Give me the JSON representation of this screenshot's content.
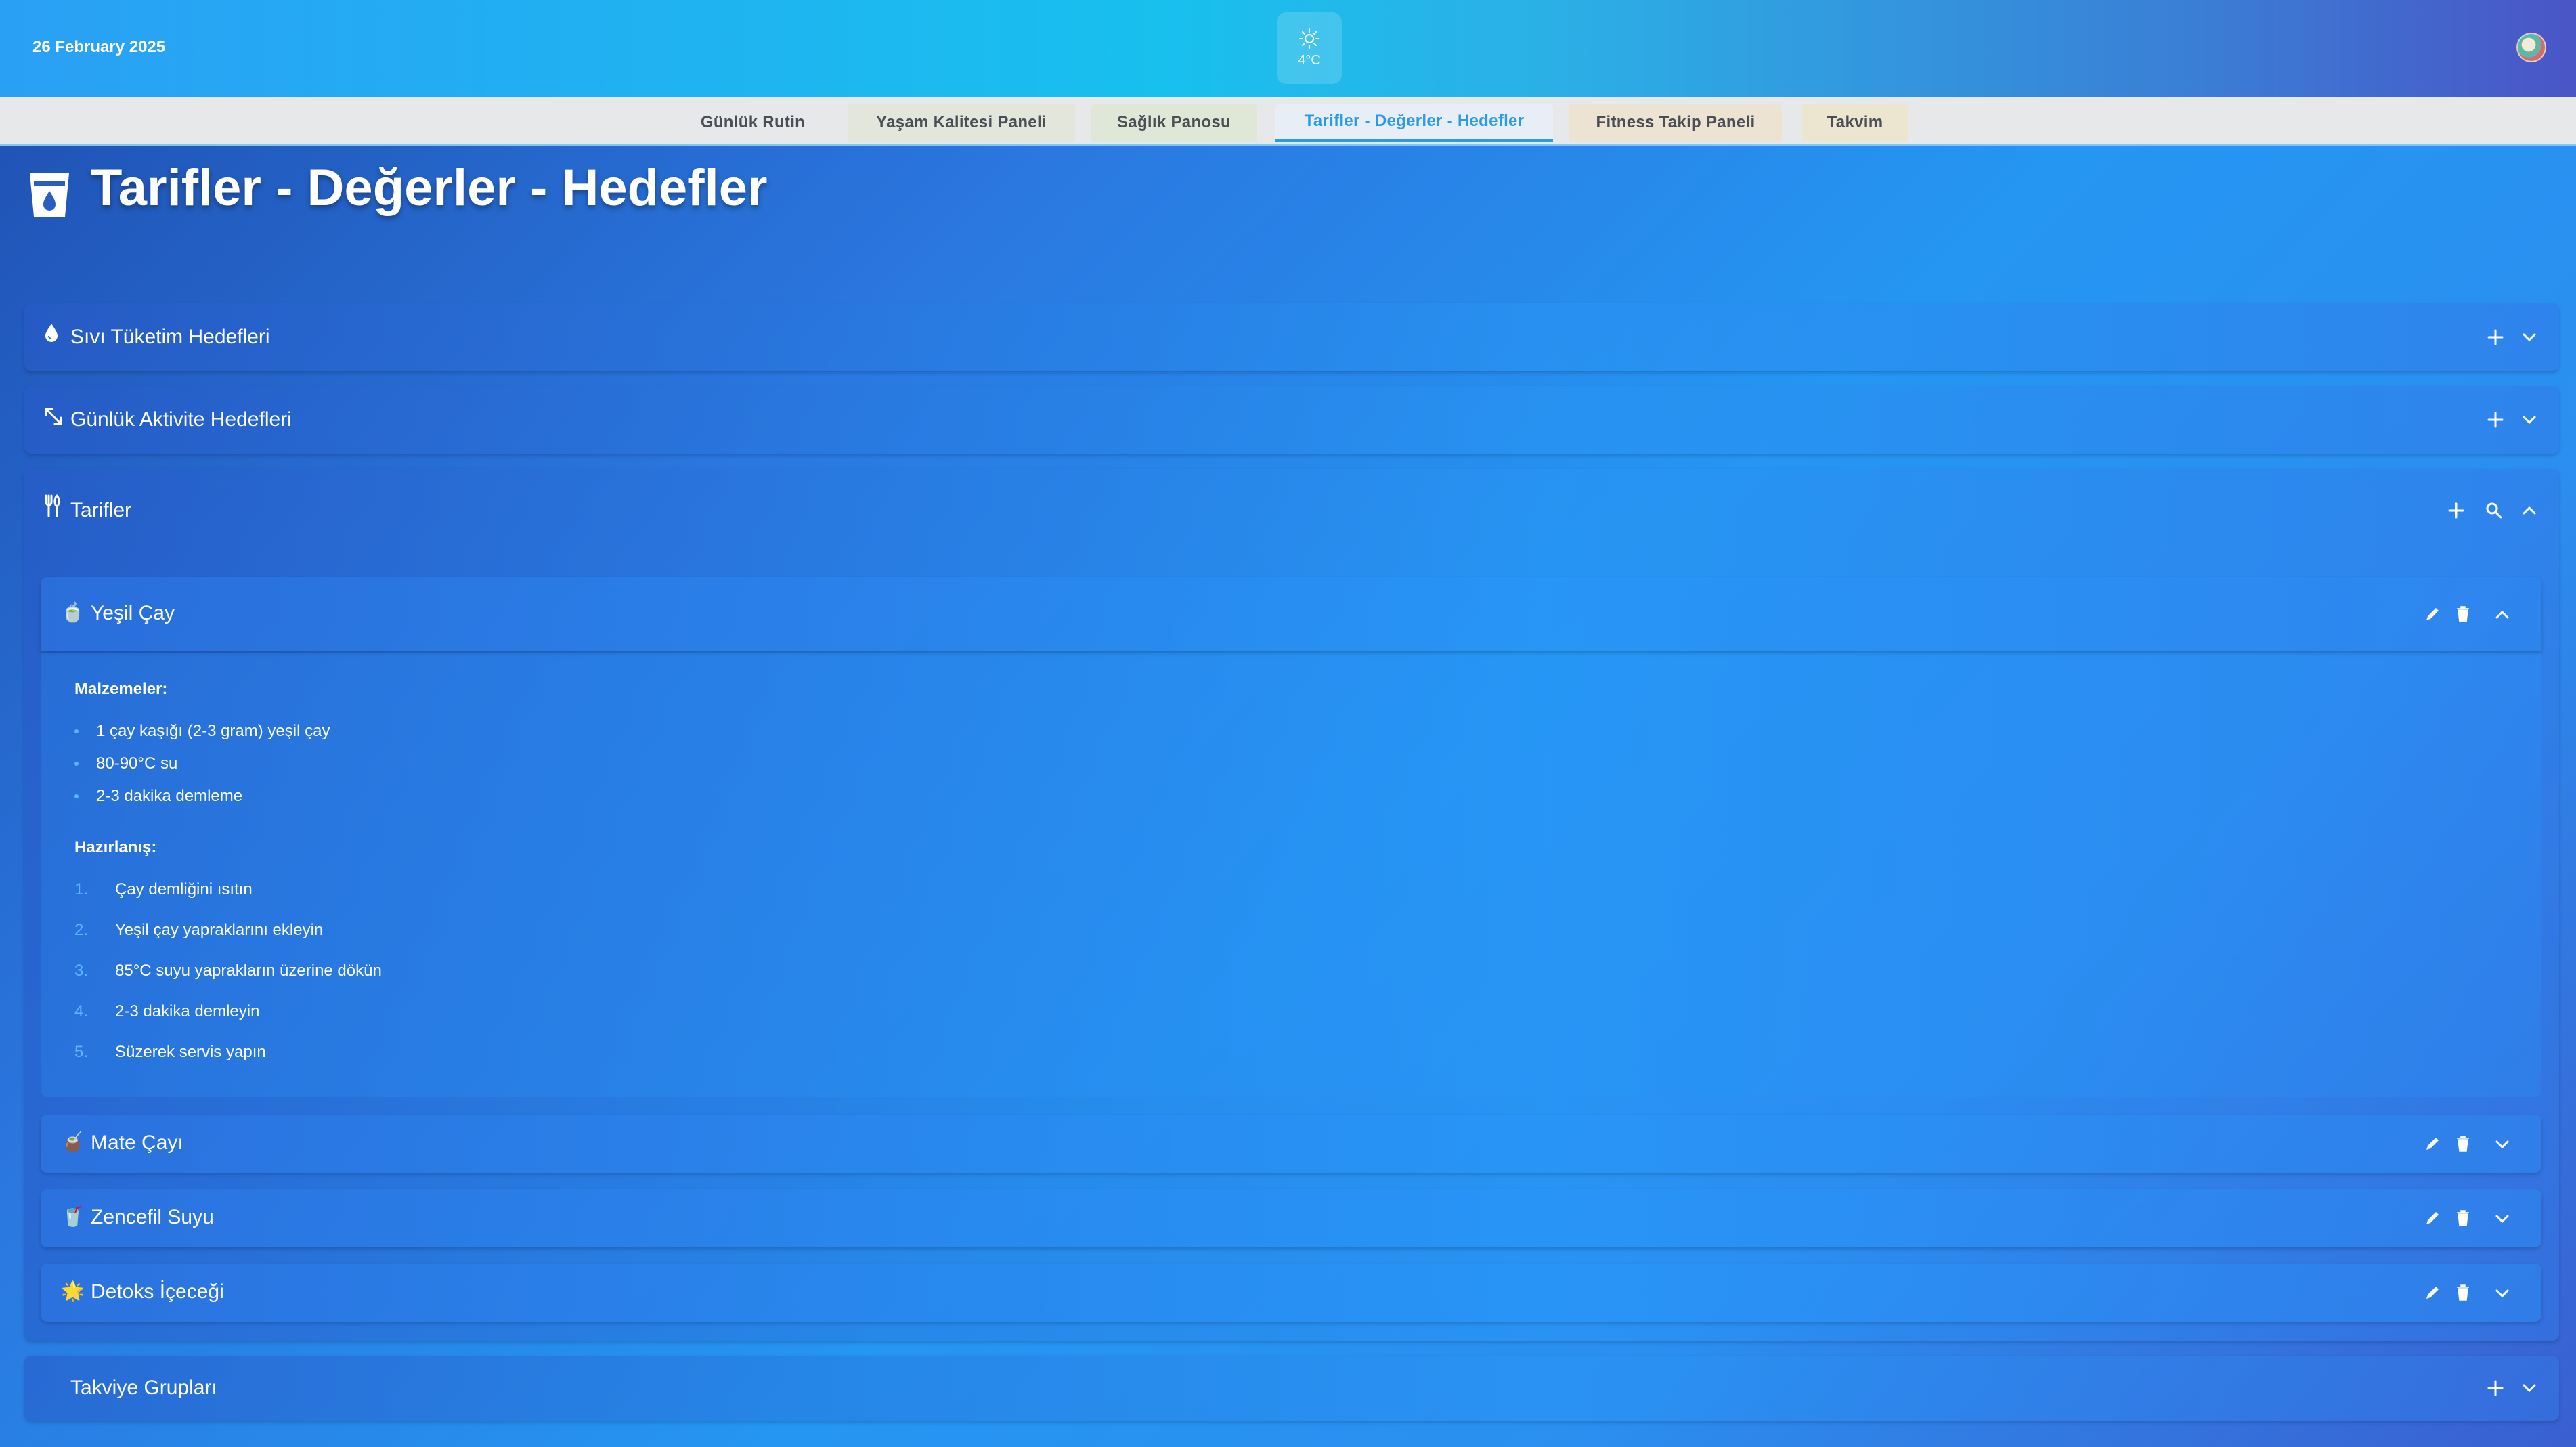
{
  "header": {
    "date": "26 February 2025",
    "weather": {
      "icon": "sun-icon",
      "temp": "4°C"
    },
    "avatar": "avatar"
  },
  "tabs": [
    {
      "label": "Günlük Rutin",
      "color": "#e7e8ea"
    },
    {
      "label": "Yaşam Kalitesi Paneli",
      "color": "#e3e6da"
    },
    {
      "label": "Sağlık Panosu",
      "color": "#dfe8d6"
    },
    {
      "label": "Tarifler - Değerler - Hedefler",
      "color": "#e7eef5",
      "active": true
    },
    {
      "label": "Fitness Takip Paneli",
      "color": "#ece3d2"
    },
    {
      "label": "Takvim",
      "color": "#ece5d0"
    }
  ],
  "page": {
    "title": "Tarifler - Değerler - Hedefler",
    "icon": "glass-water-icon"
  },
  "sections": {
    "fluid": {
      "title": "Sıvı Tüketim Hedefleri",
      "icon": "droplet-icon"
    },
    "activity": {
      "title": "Günlük Aktivite Hedefleri",
      "icon": "expand-arrows-icon"
    },
    "recipes": {
      "title": "Tarifler",
      "icon": "utensils-icon"
    },
    "supplements": {
      "title": "Takviye Grupları"
    }
  },
  "recipes": [
    {
      "title": "Yeşil Çay",
      "icon": "🍵",
      "expanded": true,
      "ingredients_label": "Malzemeler:",
      "ingredients": [
        "1 çay kaşığı (2-3 gram) yeşil çay",
        "80-90°C su",
        "2-3 dakika demleme"
      ],
      "steps_label": "Hazırlanış:",
      "steps": [
        {
          "n": "1.",
          "text": "Çay demliğini ısıtın"
        },
        {
          "n": "2.",
          "text": "Yeşil çay yapraklarını ekleyin"
        },
        {
          "n": "3.",
          "text": "85°C suyu yaprakların üzerine dökün"
        },
        {
          "n": "4.",
          "text": "2-3 dakika demleyin"
        },
        {
          "n": "5.",
          "text": "Süzerek servis yapın"
        }
      ]
    },
    {
      "title": "Mate Çayı",
      "icon": "🧉"
    },
    {
      "title": "Zencefil Suyu",
      "icon": "🥤"
    },
    {
      "title": "Detoks İçeceği",
      "icon": "🌟"
    }
  ]
}
